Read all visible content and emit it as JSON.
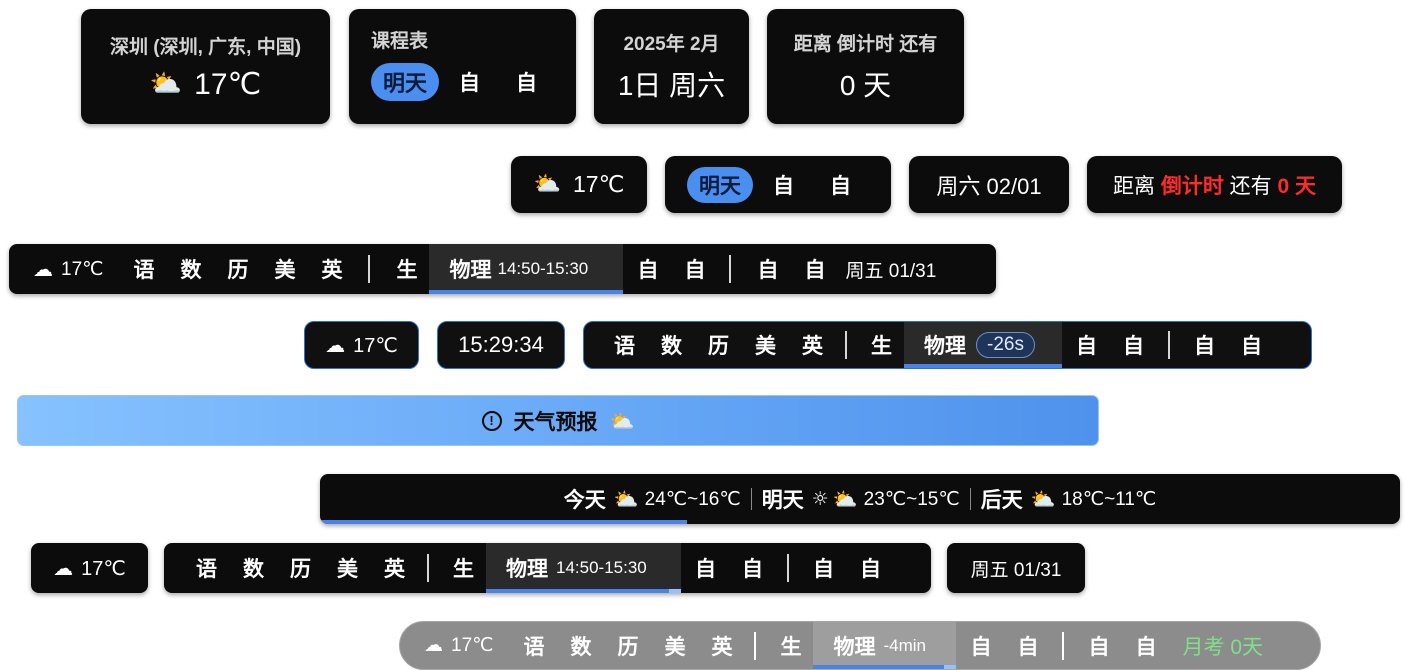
{
  "row1": {
    "weather_card": {
      "location": "深圳 (深圳, 广东, 中国)",
      "temp": "17℃"
    },
    "schedule_card": {
      "title": "课程表",
      "tomorrow": "明天",
      "items": [
        "自",
        "自"
      ]
    },
    "date_card": {
      "year_month": "2025年 2月",
      "day_week": "1日 周六"
    },
    "countdown_card": {
      "title": "距离 倒计时 还有",
      "value": "0 天"
    }
  },
  "row2": {
    "weather": {
      "temp": "17℃"
    },
    "schedule": {
      "tomorrow": "明天",
      "items": [
        "自",
        "自"
      ]
    },
    "date": {
      "text": "周六 02/01"
    },
    "countdown": {
      "prefix": "距离 ",
      "event": "倒计时",
      "mid": " 还有 ",
      "value": "0 天"
    }
  },
  "bar1": {
    "temp": "17℃",
    "classes_a": [
      "语",
      "数",
      "历",
      "美",
      "英"
    ],
    "class_b": "生",
    "current": {
      "name": "物理",
      "time": "14:50-15:30"
    },
    "classes_c": [
      "自",
      "自"
    ],
    "classes_d": [
      "自",
      "自"
    ],
    "date": "周五 01/31"
  },
  "bar2": {
    "temp": "17℃",
    "clock": "15:29:34",
    "classes_a": [
      "语",
      "数",
      "历",
      "美",
      "英"
    ],
    "class_b": "生",
    "current": {
      "name": "物理",
      "countdown": "-26s"
    },
    "classes_c": [
      "自",
      "自"
    ],
    "classes_d": [
      "自",
      "自"
    ]
  },
  "forecast_banner": {
    "title": "天气预报"
  },
  "forecast_bar": {
    "days": [
      {
        "label": "今天",
        "icons": [
          "partly-cloudy-icon"
        ],
        "range": "24℃~16℃"
      },
      {
        "label": "明天",
        "icons": [
          "sun-icon",
          "partly-cloudy-icon"
        ],
        "range": "23℃~15℃"
      },
      {
        "label": "后天",
        "icons": [
          "partly-cloudy-icon"
        ],
        "range": "18℃~11℃"
      }
    ],
    "progress": 0.34
  },
  "bar3": {
    "temp": "17℃",
    "classes_a": [
      "语",
      "数",
      "历",
      "美",
      "英"
    ],
    "class_b": "生",
    "current": {
      "name": "物理",
      "time": "14:50-15:30"
    },
    "classes_c": [
      "自",
      "自"
    ],
    "classes_d": [
      "自",
      "自"
    ],
    "date": "周五 01/31"
  },
  "bar4": {
    "temp": "17℃",
    "classes_a": [
      "语",
      "数",
      "历",
      "美",
      "英"
    ],
    "class_b": "生",
    "current": {
      "name": "物理",
      "countdown": "-4min"
    },
    "classes_c": [
      "自",
      "自"
    ],
    "classes_d": [
      "自",
      "自"
    ],
    "exam": "月考 0天"
  },
  "colors": {
    "card_bg": "#0c0c0c",
    "accent_blue": "#4a8ef0",
    "highlight_red": "#ff2b2b",
    "exam_green": "#7fe08a",
    "banner_gradient_start": "#86c2ff",
    "banner_gradient_end": "#4e92ec"
  }
}
